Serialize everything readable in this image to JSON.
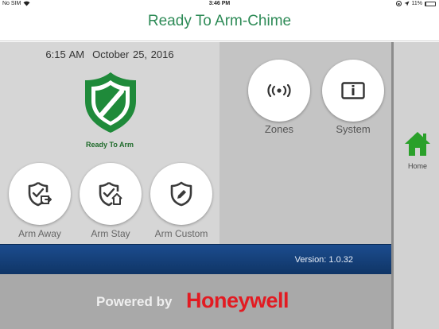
{
  "statusbar": {
    "carrier": "No SIM",
    "time": "3:46 PM",
    "battery": "11%",
    "battery_level": 0.11
  },
  "header": {
    "title": "Ready To Arm-Chime"
  },
  "panel": {
    "time": "6:15 AM",
    "date": "October 25, 2016",
    "status": "Ready To Arm"
  },
  "arm_buttons": [
    {
      "label": "Arm Away"
    },
    {
      "label": "Arm Stay"
    },
    {
      "label": "Arm Custom"
    }
  ],
  "nav_buttons": [
    {
      "label": "Zones"
    },
    {
      "label": "System"
    }
  ],
  "sidebar": {
    "home_label": "Home"
  },
  "footer": {
    "version": "Version: 1.0.32",
    "powered_by": "Powered by",
    "brand": "Honeywell"
  },
  "colors": {
    "accent_green": "#2e8b57",
    "brand_red": "#e21b22",
    "bar_blue": "#1c4c8e"
  }
}
